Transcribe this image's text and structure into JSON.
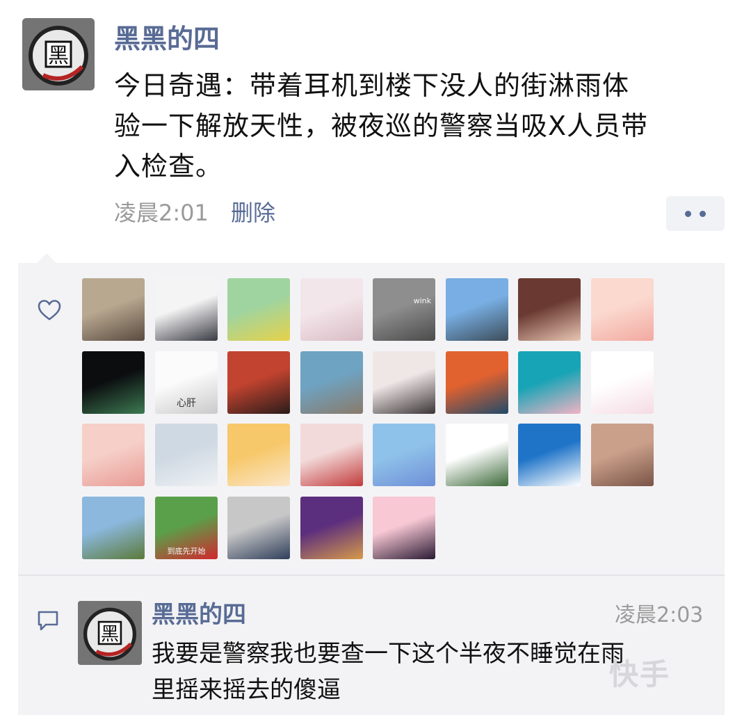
{
  "post": {
    "author": "黑黑的四",
    "avatar_glyph": "黑",
    "body_lines": [
      "今日奇遇：带着耳机到楼下没人的街淋雨体",
      "验一下解放天性，被夜巡的警察当吸X人员带",
      "入检查。"
    ],
    "time": "凌晨2:01",
    "delete_label": "删除",
    "more_icon": "more-dots-icon"
  },
  "likes": {
    "icon": "heart-outline-icon",
    "avatars": [
      {
        "name": "liker-avatar-1",
        "glyph": "",
        "caption": "",
        "colors": [
          "#b8a890",
          "#5a4a40"
        ]
      },
      {
        "name": "liker-avatar-2",
        "glyph": "",
        "caption": "",
        "colors": [
          "#f4f4f4",
          "#3a3a44"
        ]
      },
      {
        "name": "liker-avatar-3",
        "glyph": "",
        "caption": "",
        "colors": [
          "#9fd4a0",
          "#e6d24a"
        ]
      },
      {
        "name": "liker-avatar-4",
        "glyph": "",
        "caption": "",
        "colors": [
          "#f3e6ea",
          "#d9bcc5"
        ]
      },
      {
        "name": "liker-avatar-5",
        "glyph": "",
        "caption": "wink",
        "colors": [
          "#8e8e8e",
          "#4b4b4b"
        ]
      },
      {
        "name": "liker-avatar-6",
        "glyph": "",
        "caption": "",
        "colors": [
          "#78aee3",
          "#3c4d5a"
        ]
      },
      {
        "name": "liker-avatar-7",
        "glyph": "",
        "caption": "",
        "colors": [
          "#6a3a32",
          "#e9c6b4"
        ]
      },
      {
        "name": "liker-avatar-8",
        "glyph": "",
        "caption": "",
        "colors": [
          "#fbd9cf",
          "#f2a9a0"
        ]
      },
      {
        "name": "liker-avatar-9",
        "glyph": "",
        "caption": "",
        "colors": [
          "#0b0d0f",
          "#3d7a52"
        ]
      },
      {
        "name": "liker-avatar-10",
        "glyph": "",
        "caption": "心肝",
        "colors": [
          "#fbfbfb",
          "#c9c9c9"
        ]
      },
      {
        "name": "liker-avatar-11",
        "glyph": "",
        "caption": "",
        "colors": [
          "#c2432f",
          "#2a1c1a"
        ]
      },
      {
        "name": "liker-avatar-12",
        "glyph": "",
        "caption": "",
        "colors": [
          "#6ea3c2",
          "#8a7a6a"
        ]
      },
      {
        "name": "liker-avatar-13",
        "glyph": "",
        "caption": "",
        "colors": [
          "#efe7e6",
          "#3b3436"
        ]
      },
      {
        "name": "liker-avatar-14",
        "glyph": "",
        "caption": "",
        "colors": [
          "#e2622f",
          "#1f4a6a"
        ]
      },
      {
        "name": "liker-avatar-15",
        "glyph": "",
        "caption": "",
        "colors": [
          "#17a4b6",
          "#f2b4c4"
        ]
      },
      {
        "name": "liker-avatar-16",
        "glyph": "",
        "caption": "",
        "colors": [
          "#ffffff",
          "#f5dbe4"
        ]
      },
      {
        "name": "liker-avatar-17",
        "glyph": "",
        "caption": "",
        "colors": [
          "#f6cfc8",
          "#e79b94"
        ]
      },
      {
        "name": "liker-avatar-18",
        "glyph": "",
        "caption": "",
        "colors": [
          "#cfd9e3",
          "#eef1f4"
        ]
      },
      {
        "name": "liker-avatar-19",
        "glyph": "",
        "caption": "",
        "colors": [
          "#f7c86a",
          "#fbe6c8"
        ]
      },
      {
        "name": "liker-avatar-20",
        "glyph": "",
        "caption": "",
        "colors": [
          "#f3dada",
          "#c23b3b"
        ]
      },
      {
        "name": "liker-avatar-21",
        "glyph": "",
        "caption": "",
        "colors": [
          "#8fc2ea",
          "#6f8fd6"
        ]
      },
      {
        "name": "liker-avatar-22",
        "glyph": "",
        "caption": "",
        "colors": [
          "#ffffff",
          "#3d6a3a"
        ]
      },
      {
        "name": "liker-avatar-23",
        "glyph": "",
        "caption": "",
        "colors": [
          "#1f74c8",
          "#ffffff"
        ]
      },
      {
        "name": "liker-avatar-24",
        "glyph": "",
        "caption": "",
        "colors": [
          "#caa08a",
          "#7a5448"
        ]
      },
      {
        "name": "liker-avatar-25",
        "glyph": "",
        "caption": "",
        "colors": [
          "#8cb8de",
          "#5b7a3a"
        ]
      },
      {
        "name": "liker-avatar-26",
        "glyph": "",
        "caption": "到底先开始",
        "colors": [
          "#5aa04a",
          "#d2282d"
        ]
      },
      {
        "name": "liker-avatar-27",
        "glyph": "",
        "caption": "",
        "colors": [
          "#c7c7c7",
          "#2f3e5a"
        ]
      },
      {
        "name": "liker-avatar-28",
        "glyph": "",
        "caption": "",
        "colors": [
          "#5c2e7e",
          "#d69a4a"
        ]
      },
      {
        "name": "liker-avatar-29",
        "glyph": "",
        "caption": "",
        "colors": [
          "#f8c8d4",
          "#2a1a33"
        ]
      }
    ]
  },
  "comment": {
    "icon": "comment-bubble-icon",
    "author": "黑黑的四",
    "avatar_glyph": "黑",
    "time": "凌晨2:03",
    "text_lines": [
      "我要是警察我也要查一下这个半夜不睡觉在雨",
      "里摇来摇去的傻逼"
    ]
  },
  "watermark": "快手"
}
